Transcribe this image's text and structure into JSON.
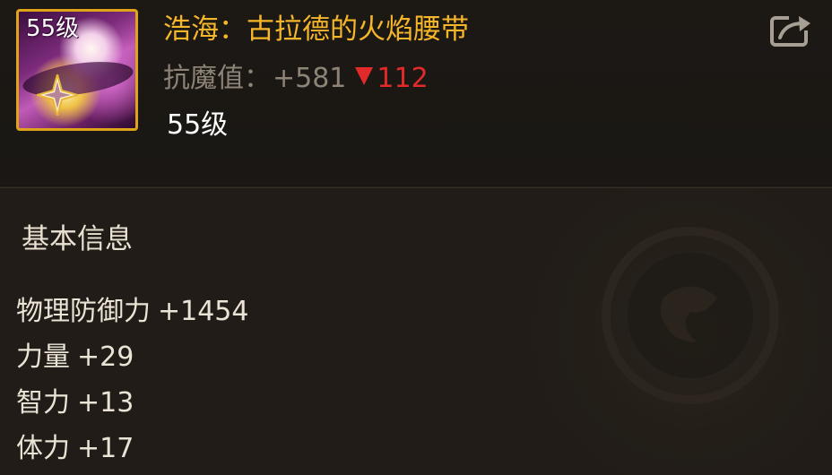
{
  "item": {
    "icon_name": "belt-item-icon",
    "icon_level_badge": "55级",
    "name": "浩海：古拉德的火焰腰带",
    "name_color": "#f6b629",
    "frame_color": "#e0a418",
    "level": "55级"
  },
  "magic_resist": {
    "label": "抗魔值：",
    "value": "+581",
    "delta": "112",
    "delta_direction": "down",
    "delta_color": "#e32a2a"
  },
  "share": {
    "icon": "share-icon"
  },
  "basic_info": {
    "title": "基本信息",
    "attributes": [
      {
        "label": "物理防御力",
        "value": "+1454"
      },
      {
        "label": "力量",
        "value": "+29"
      },
      {
        "label": "智力",
        "value": "+13"
      },
      {
        "label": "体力",
        "value": "+17"
      }
    ]
  }
}
